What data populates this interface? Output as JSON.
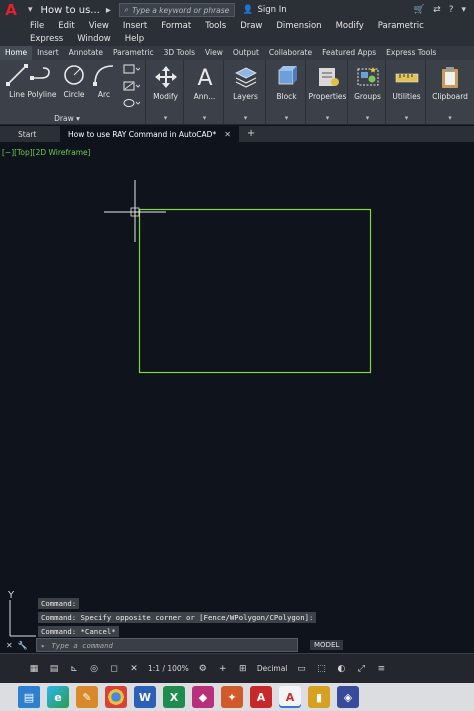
{
  "titlebar": {
    "app_title": "How to us...",
    "search_placeholder": "Type a keyword or phrase",
    "sign_in": "Sign In"
  },
  "menubar": {
    "items": [
      "File",
      "Edit",
      "View",
      "Insert",
      "Format",
      "Tools",
      "Draw",
      "Dimension",
      "Modify",
      "Parametric",
      "Express",
      "Window",
      "Help"
    ]
  },
  "ribbon_tabs": {
    "items": [
      "Home",
      "Insert",
      "Annotate",
      "Parametric",
      "3D Tools",
      "View",
      "Output",
      "Collaborate",
      "Featured Apps",
      "Express Tools"
    ],
    "active": "Home"
  },
  "ribbon": {
    "draw_tools": [
      "Line",
      "Polyline",
      "Circle",
      "Arc"
    ],
    "draw_group_label": "Draw",
    "panels": [
      "Modify",
      "Ann...",
      "Layers",
      "Block",
      "Properties",
      "Groups",
      "Utilities",
      "Clipboard"
    ]
  },
  "doc_tabs": {
    "start": "Start",
    "active": "How to use RAY Command in AutoCAD*"
  },
  "viewport": {
    "label": "[−][Top][2D Wireframe]",
    "rect_color": "#7ddc3a",
    "axis_label": "Y"
  },
  "command": {
    "history": [
      "Command:",
      "Command: Specify opposite corner or [Fence/WPolygon/CPolygon]:",
      "Command: *Cancel*"
    ],
    "placeholder": "Type a command",
    "model_tab": "MODEL"
  },
  "statusbar": {
    "scale": "1:1 / 100%",
    "units": "Decimal"
  }
}
